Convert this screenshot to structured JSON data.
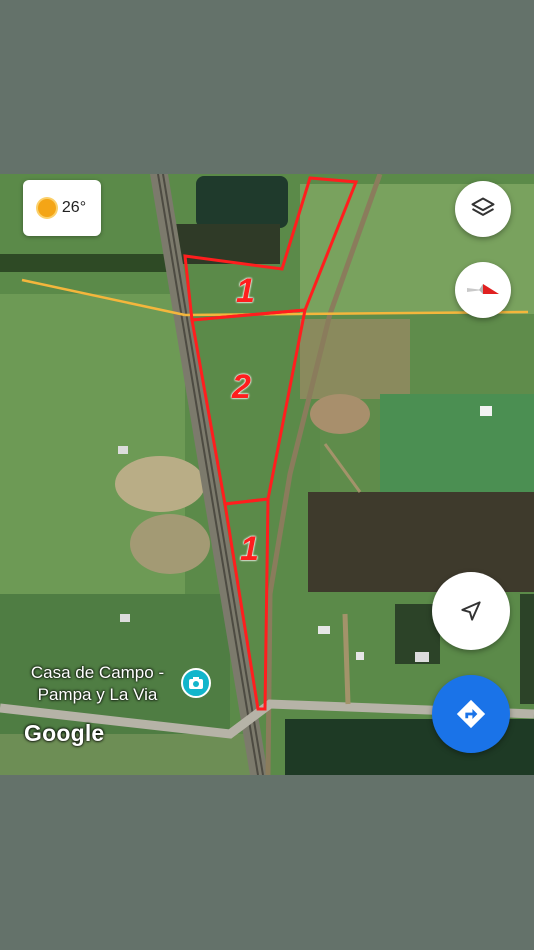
{
  "weather": {
    "temperature": "26°",
    "icon": "sun-icon"
  },
  "controls": {
    "layers_icon": "layers-icon",
    "compass_icon": "compass-icon",
    "locate_icon": "navigation-arrow-icon",
    "directions_icon": "directions-icon"
  },
  "place": {
    "label_line1": "Casa de Campo -",
    "label_line2": "Pampa y La Via",
    "icon": "camera-icon"
  },
  "attribution": "Google",
  "plots": [
    {
      "label": "1"
    },
    {
      "label": "2"
    },
    {
      "label": "1"
    }
  ],
  "colors": {
    "plot_outline": "#ff1e1e",
    "boundary_line": "#f4b63c",
    "directions_button": "#1a73e8",
    "place_pin": "#12b5cb"
  }
}
